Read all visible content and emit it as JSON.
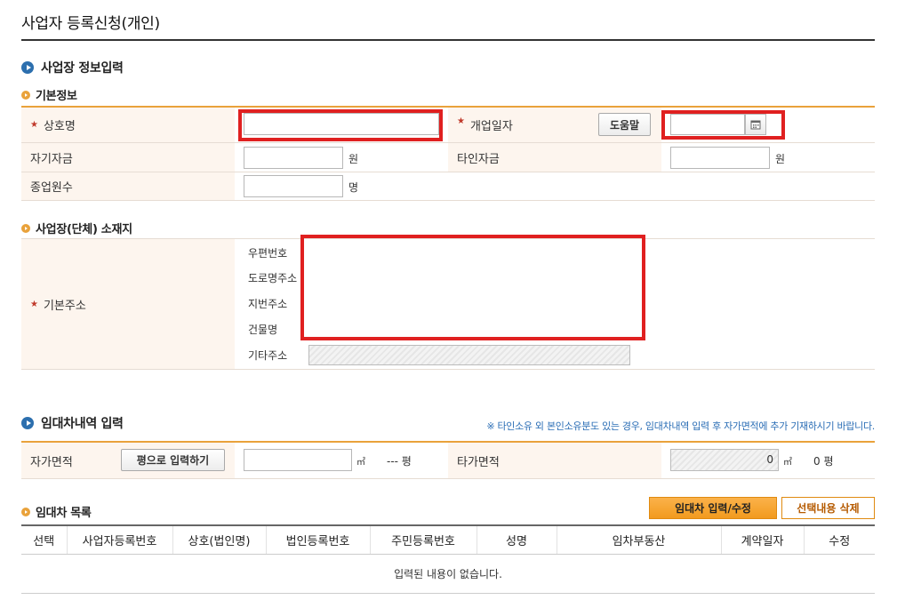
{
  "page": {
    "title": "사업자 등록신청(개인)"
  },
  "business_info": {
    "section_title": "사업장 정보입력",
    "basic": {
      "title": "기본정보",
      "trade_name_label": "상호명",
      "trade_name_value": "",
      "open_date_label": "개업일자",
      "help_button": "도움말",
      "open_date_value": "",
      "own_capital_label": "자기자금",
      "own_capital_value": "",
      "own_capital_unit": "원",
      "other_capital_label": "타인자금",
      "other_capital_value": "",
      "other_capital_unit": "원",
      "employees_label": "종업원수",
      "employees_value": "",
      "employees_unit": "명"
    },
    "location": {
      "title": "사업장(단체) 소재지",
      "address_label": "기본주소",
      "postal_code_label": "우편번호",
      "road_address_label": "도로명주소",
      "lot_address_label": "지번주소",
      "building_label": "건물명",
      "other_address_label": "기타주소"
    }
  },
  "lease": {
    "section_title": "임대차내역 입력",
    "notice": "※ 타인소유 외 본인소유분도 있는 경우, 임대차내역 입력 후 자가면적에 추가 기재하시기 바랍니다.",
    "own_area_label": "자가면적",
    "pyeong_button": "평으로 입력하기",
    "own_area_value": "",
    "own_area_unit": "㎡",
    "own_pyeong": "--- 평",
    "other_area_label": "타가면적",
    "other_area_value": "0",
    "other_area_unit": "㎡",
    "other_pyeong": "0 평"
  },
  "lease_list": {
    "title": "임대차 목록",
    "input_button": "임대차 입력/수정",
    "delete_button": "선택내용 삭제",
    "columns": [
      "선택",
      "사업자등록번호",
      "상호(법인명)",
      "법인등록번호",
      "주민등록번호",
      "성명",
      "임차부동산",
      "계약일자",
      "수정"
    ],
    "empty_message": "입력된 내용이 없습니다."
  }
}
